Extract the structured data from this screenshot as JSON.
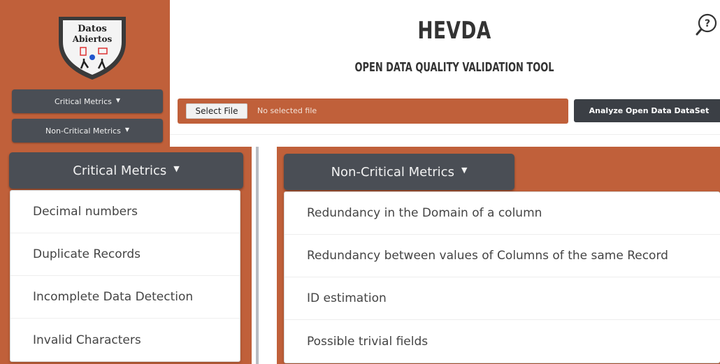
{
  "header": {
    "title": "HEVDA",
    "subtitle": "OPEN DATA QUALITY VALIDATION TOOL"
  },
  "logo": {
    "line1": "Datos",
    "line2": "Abiertos"
  },
  "sidebar": {
    "critical_label": "Critical Metrics",
    "noncritical_label": "Non-Critical Metrics"
  },
  "file": {
    "select_label": "Select File",
    "status": "No selected file",
    "analyze_label": "Analyze Open Data DataSet"
  },
  "critical_menu": {
    "label": "Critical Metrics",
    "items": [
      "Decimal numbers",
      "Duplicate Records",
      "Incomplete Data Detection",
      "Invalid Characters"
    ]
  },
  "noncritical_menu": {
    "label": "Non-Critical Metrics",
    "items": [
      "Redundancy in the Domain of a column",
      "Redundancy between values of Columns of the same Record",
      "ID estimation",
      "Possible trivial fields"
    ]
  },
  "colors": {
    "accent": "#c0603a",
    "dark_button": "#4a4e55"
  }
}
